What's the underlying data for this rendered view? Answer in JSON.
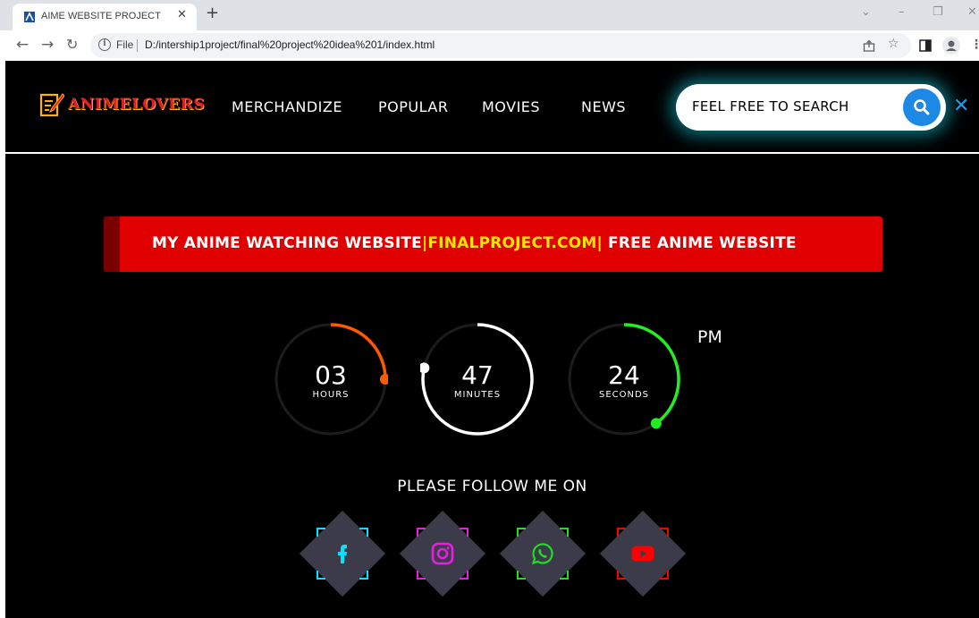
{
  "browser": {
    "tab_title": "AIME WEBSITE PROJECT",
    "file_label": "File",
    "url": "D:/intership1project/final%20project%20idea%201/index.html"
  },
  "site": {
    "logo_text": "ANIMELOVERS",
    "nav": [
      {
        "label": "MERCHANDIZE"
      },
      {
        "label": "POPULAR"
      },
      {
        "label": "MOVIES"
      },
      {
        "label": "NEWS"
      }
    ],
    "search_placeholder": "FEEL FREE TO SEARCH",
    "banner": {
      "part1": "MY ANIME WATCHING WEBSITE",
      "highlight": "|FINALPROJECT.COM|",
      "part2": " FREE ANIME WEBSITE"
    },
    "clock": {
      "hours": {
        "value": "03",
        "unit": "HOURS",
        "color": "#ff5a00",
        "progress": 0.25
      },
      "minutes": {
        "value": "47",
        "unit": "MINUTES",
        "color": "#ffffff",
        "progress": 0.7833
      },
      "seconds": {
        "value": "24",
        "unit": "SECONDS",
        "color": "#22ee22",
        "progress": 0.4
      },
      "ampm": "PM"
    },
    "follow_text": "PLEASE FOLLOW ME ON",
    "social": [
      {
        "icon": "facebook-icon",
        "color": "#00e5ff"
      },
      {
        "icon": "instagram-icon",
        "color": "#e91ee0"
      },
      {
        "icon": "whatsapp-icon",
        "color": "#22dd22"
      },
      {
        "icon": "youtube-icon",
        "color": "#ff0000"
      }
    ]
  }
}
